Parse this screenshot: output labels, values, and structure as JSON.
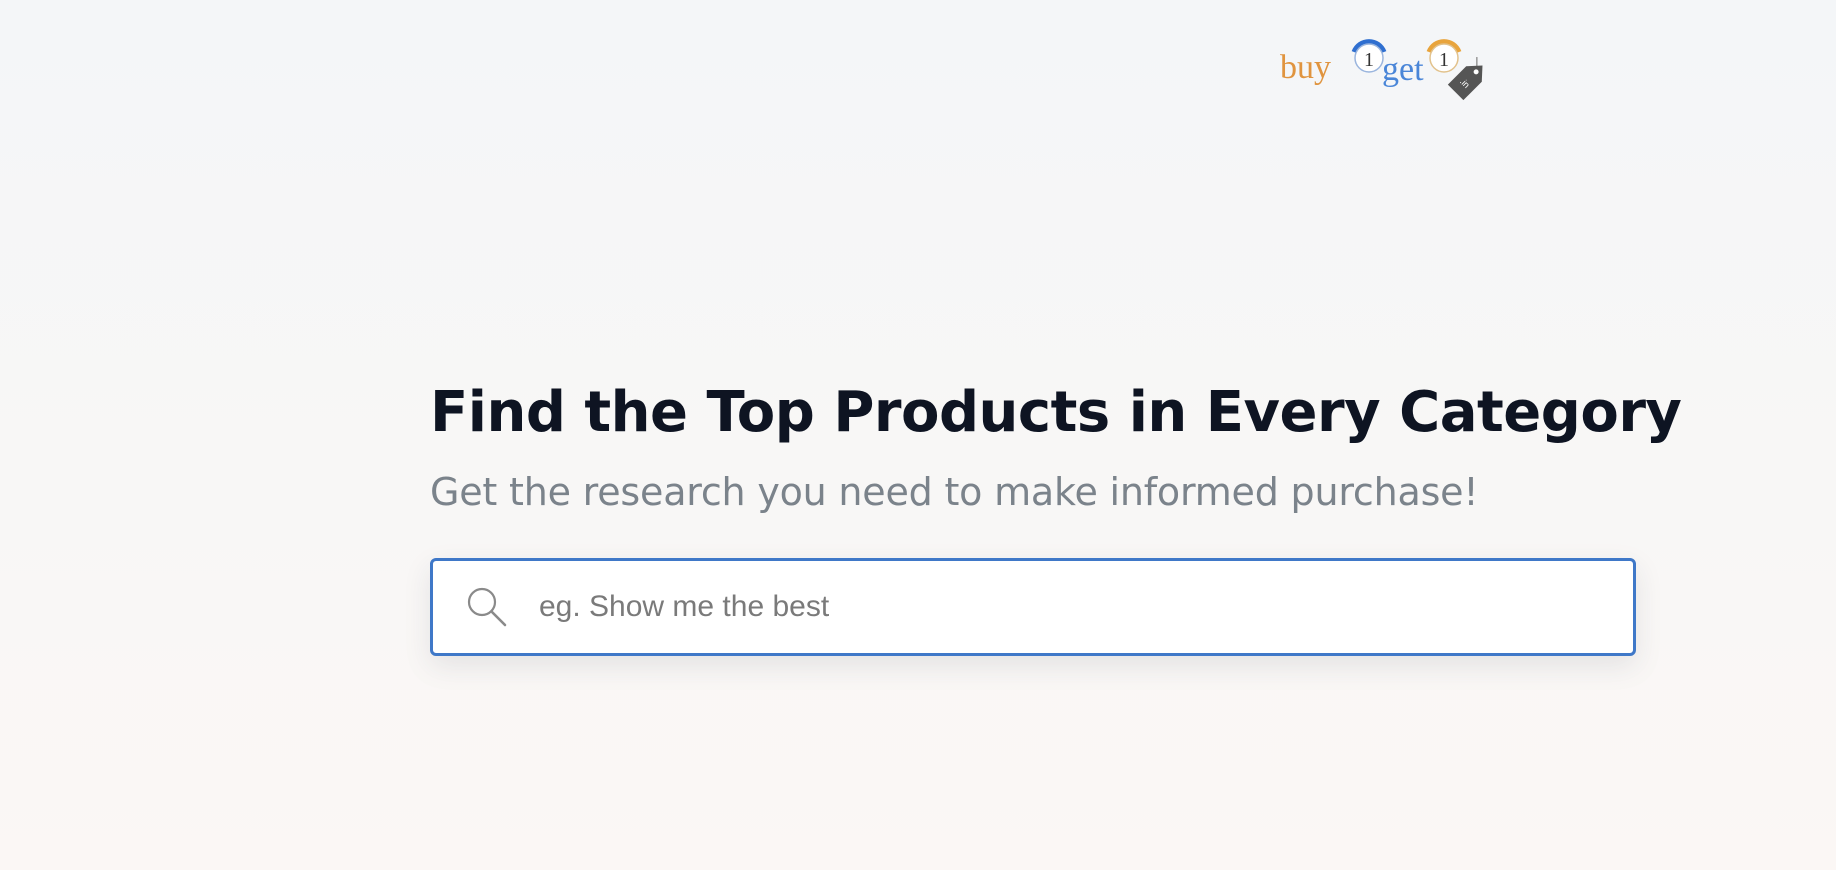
{
  "brand": {
    "logo": {
      "word_buy": "buy",
      "word_get": "get",
      "badge_one_a": "1",
      "badge_one_b": "1",
      "tag_text": ".in"
    },
    "colors": {
      "buy_orange": "#e0943f",
      "get_blue": "#4a86d8",
      "tag_gray": "#555555"
    }
  },
  "hero": {
    "headline": "Find the Top Products in Every Category",
    "subheadline": "Get the research you need to make informed purchase!"
  },
  "search": {
    "icon": "search-icon",
    "placeholder": "eg. Show me the best",
    "value": ""
  },
  "theme": {
    "accent": "#3f78c8",
    "headline_color": "#0e1422",
    "subhead_color": "#7b838b"
  }
}
